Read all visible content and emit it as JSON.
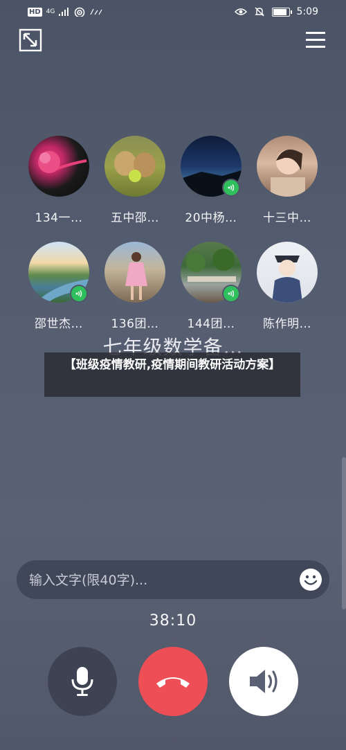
{
  "status": {
    "network": "HD",
    "signal": "4G",
    "time": "5:09"
  },
  "members": [
    {
      "name": "134一…",
      "speaking": false,
      "avatar": "flower"
    },
    {
      "name": "五中邵…",
      "speaking": false,
      "avatar": "monkeys"
    },
    {
      "name": "20中杨…",
      "speaking": true,
      "avatar": "night-sky"
    },
    {
      "name": "十三中…",
      "speaking": false,
      "avatar": "girl-portrait"
    },
    {
      "name": "邵世杰…",
      "speaking": true,
      "avatar": "river"
    },
    {
      "name": "136团…",
      "speaking": false,
      "avatar": "woman-pink"
    },
    {
      "name": "144团…",
      "speaking": true,
      "avatar": "park"
    },
    {
      "name": "陈作明…",
      "speaking": false,
      "avatar": "anime-boy"
    }
  ],
  "group_title": "七年级数学备…",
  "overlay_text": "【班级疫情教研,疫情期间教研活动方案】",
  "input": {
    "placeholder": "输入文字(限40字)..."
  },
  "timer": "38:10",
  "icons": {
    "minimize": "minimize-icon",
    "menu": "menu-icon",
    "emoji": "emoji-icon",
    "mic": "microphone-icon",
    "hangup": "hang-up-icon",
    "speaker": "speaker-icon"
  },
  "colors": {
    "hangup": "#ee4e55",
    "speaking": "#2fbf5c",
    "mic_bg": "#3d4352",
    "speaker_bg": "#ffffff"
  }
}
